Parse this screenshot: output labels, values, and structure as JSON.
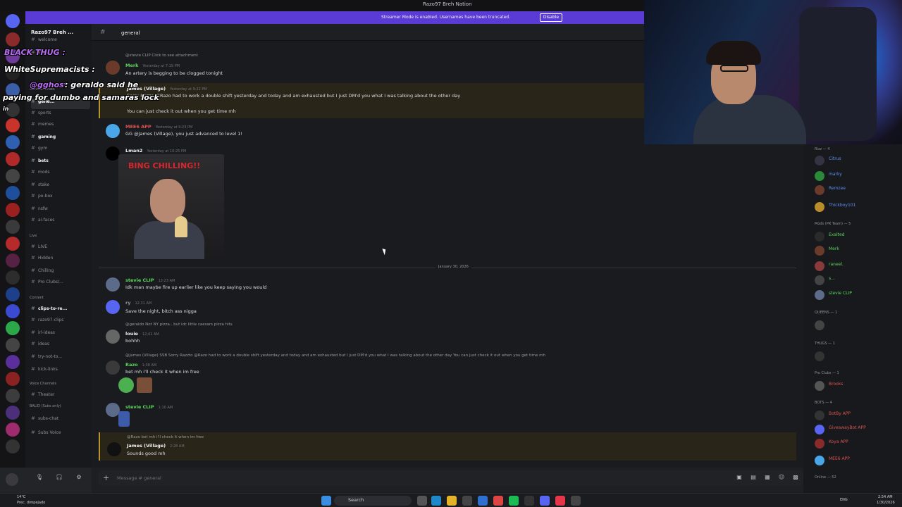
{
  "window": {
    "title": "Razo97 Breh Nation"
  },
  "streamer_banner": {
    "message": "Streamer Mode is enabled. Usernames have been truncated.",
    "button": "Disable"
  },
  "guild": {
    "name": "Razo97 Breh ..."
  },
  "channels": {
    "items": [
      {
        "label": "welcome",
        "style": "normal"
      },
      {
        "label": "annou...",
        "style": "normal"
      },
      {
        "label": "General Chats",
        "style": "category"
      },
      {
        "label": "gene...",
        "style": "selected"
      },
      {
        "label": "sports",
        "style": "normal"
      },
      {
        "label": "memes",
        "style": "normal"
      },
      {
        "label": "gaming",
        "style": "active"
      },
      {
        "label": "gym",
        "style": "normal"
      },
      {
        "label": "bets",
        "style": "active"
      },
      {
        "label": "mods",
        "style": "normal"
      },
      {
        "label": "stake",
        "style": "normal"
      },
      {
        "label": "po-box",
        "style": "normal"
      },
      {
        "label": "nsfw",
        "style": "normal"
      },
      {
        "label": "ai-faces",
        "style": "normal"
      },
      {
        "label": "Live",
        "style": "category"
      },
      {
        "label": "LIVE",
        "style": "normal"
      },
      {
        "label": "Hidden",
        "style": "normal"
      },
      {
        "label": "Chilling",
        "style": "normal"
      },
      {
        "label": "Pro Clubs/...",
        "style": "normal"
      },
      {
        "label": "Content",
        "style": "category"
      },
      {
        "label": "clips-to-re...",
        "style": "active"
      },
      {
        "label": "razo97-clips",
        "style": "normal"
      },
      {
        "label": "irl-ideas",
        "style": "normal"
      },
      {
        "label": "ideas",
        "style": "normal"
      },
      {
        "label": "try-not-to...",
        "style": "normal"
      },
      {
        "label": "kick-links",
        "style": "normal"
      },
      {
        "label": "Voice Channels",
        "style": "category"
      },
      {
        "label": "Theater",
        "style": "normal"
      },
      {
        "label": "BALID (Subs only)",
        "style": "category"
      },
      {
        "label": "subs-chat",
        "style": "normal"
      },
      {
        "label": "Subs Voice",
        "style": "normal"
      }
    ]
  },
  "header": {
    "channel": "general"
  },
  "messages": {
    "m1_reply": "@stevie CLIP Click to see attachment",
    "m1_author": "Merk",
    "m1_time": "Yesterday at 7:19 PM",
    "m1_text": "An artery is begging to be clogged tonight",
    "m2_author": "James (Village)",
    "m2_time": "Yesterday at 9:22 PM",
    "m2_text": "Sorry Razzo @Razo had to work a double shift yesterday and today and am exhausted but I just DM'd you what I was talking about the other day",
    "m2_text2": "You can just check it out when you get time mh",
    "m3_author": "MEE6 APP",
    "m3_time": "Yesterday at 9:23 PM",
    "m3_text": "GG @James (Village), you just advanced to level 1!",
    "m4_author": "Lman2",
    "m4_time": "Yesterday at 10:25 PM",
    "m4_gif_caption": "BING CHILLING!!",
    "date_divider": "January 30, 2026",
    "m5_author": "stevie CLIP",
    "m5_time": "12:23 AM",
    "m5_text": "Idk man maybe fire up earlier like you keep saying you would",
    "m6_author": "ry",
    "m6_time": "12:31 AM",
    "m6_text": "Save the night, bitch ass nigga",
    "m7_reply": "@geraldo Not NY pizza.. but idc little caesars pizza hits",
    "m7_author": "louie",
    "m7_time": "12:41 AM",
    "m7_text": "bohhh",
    "m8_reply": "@James (Village) SSB Sorry Razzto @Razo had to work a double shift yesterday and today and am exhausted but I just DM'd you what I was talking about the other day You can just check it out when you get time mh",
    "m8_author": "Razo",
    "m8_time": "1:08 AM",
    "m8_text": "bet mh i'll check it when im free",
    "m9_author": "stevie CLIP",
    "m9_time": "1:10 AM",
    "m10_reply": "@Razo bet mh i'll check it when im free",
    "m10_author": "James (Village)",
    "m10_time": "2:28 AM",
    "m10_text": "Sounds good mh"
  },
  "composer": {
    "placeholder": "Message # general"
  },
  "members": {
    "g1": "Rizz — 4",
    "g1_items": [
      "Citrus",
      "marky",
      "Remzee",
      "Thickboy101"
    ],
    "g2": "Mods (PR Team) — 5",
    "g2_items": [
      "Exalted",
      "Merk",
      "raneel.",
      "s...",
      "stevie CLIP"
    ],
    "g3": "QUEENS — 1",
    "g4": "THUGS — 1",
    "g5": "Pro Clubs — 1",
    "g5_items": [
      "Brooks"
    ],
    "g6": "BOTS — 4",
    "g6_items": [
      "BotBy APP",
      "GiveawayBot APP",
      "Koya APP",
      "MEE6 APP"
    ],
    "g7": "Online — 52"
  },
  "overlay_chat": {
    "line1_user": "BLACK THUG :",
    "line2_user": "WhiteSupremacists :",
    "line3_user": "@gghost",
    "line3_text": ": geraldo said he",
    "line4_text": "paying for dumbo and samaras lock",
    "line5_text": "in"
  },
  "taskbar": {
    "search": "Search",
    "weather_temp": "14°C",
    "weather_desc": "Prec. dimpejado",
    "lang": "ENG",
    "time": "2:54 AM",
    "date": "1/30/2026"
  },
  "colors": {
    "streamer_banner": "#5b3bd6",
    "accent": "#5865f2",
    "highlight": "#b8932d"
  }
}
